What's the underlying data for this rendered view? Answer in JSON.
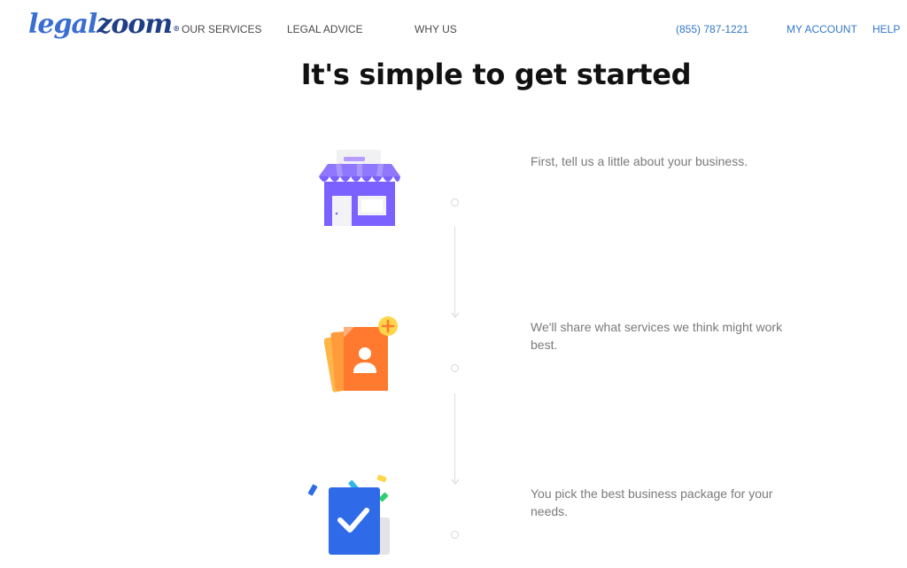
{
  "header": {
    "logo": {
      "part1": "legal",
      "part2": "zoom",
      "reg": "®"
    },
    "nav": {
      "our_services": "OUR SERVICES",
      "legal_advice": "LEGAL ADVICE",
      "why_us": "WHY US",
      "phone": "(855) 787-1221",
      "my_account": "MY ACCOUNT",
      "help": "HELP"
    }
  },
  "main": {
    "title": "It's simple to get started",
    "steps": [
      {
        "icon": "storefront-icon",
        "text": "First, tell us a little about your business."
      },
      {
        "icon": "add-document-icon",
        "text": "We'll share what services we think might work best."
      },
      {
        "icon": "checklist-confetti-icon",
        "text": "You pick the best business package for your needs."
      }
    ]
  },
  "colors": {
    "brand_blue": "#3a6fd1",
    "brand_navy": "#1f3e86",
    "link_blue": "#3177c7",
    "store_purple": "#7b61ff",
    "doc_orange": "#ff7a2e",
    "check_blue": "#2f6be8"
  }
}
